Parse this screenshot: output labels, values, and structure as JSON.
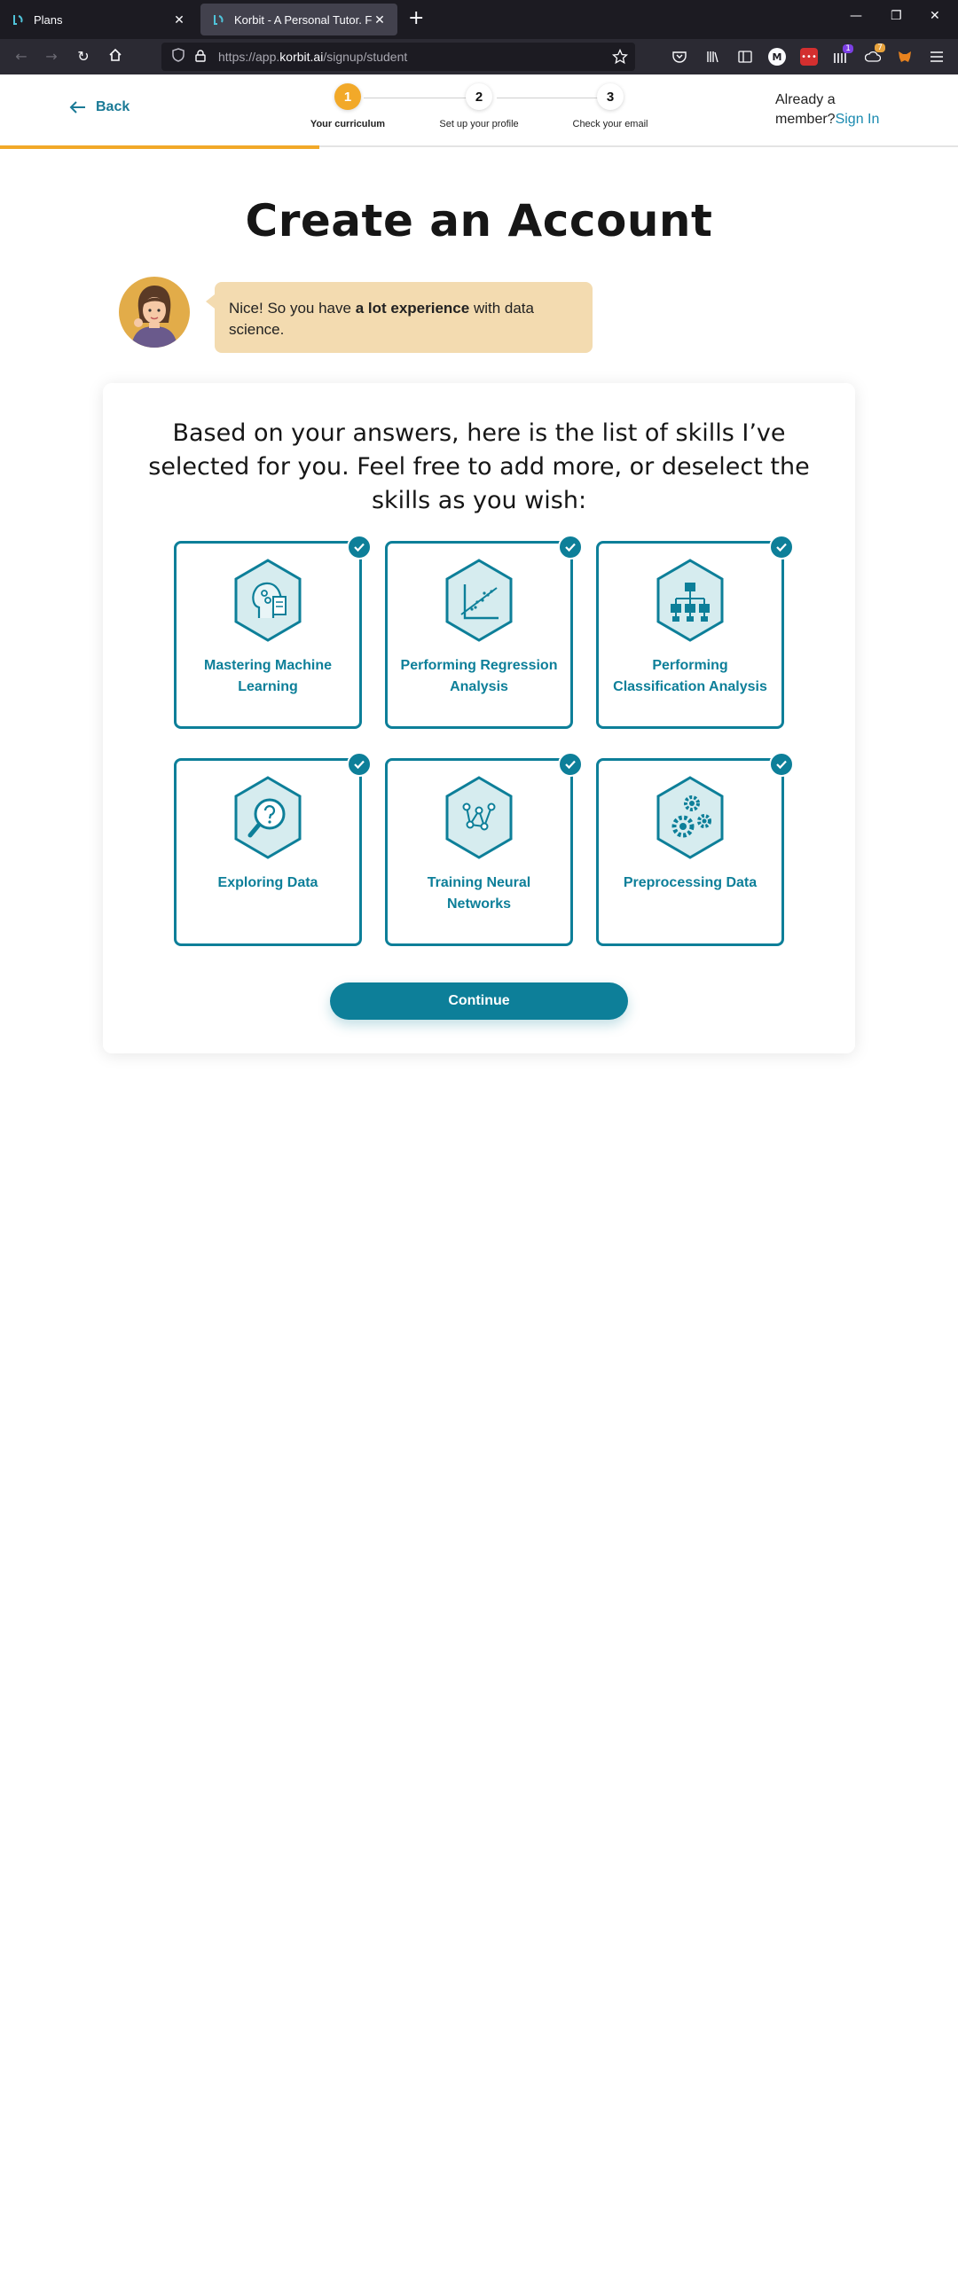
{
  "browser": {
    "tabs": [
      {
        "title": "Plans",
        "active": false
      },
      {
        "title": "Korbit - A Personal Tutor. For Ev",
        "active": true
      }
    ],
    "url_prefix": "https://app.",
    "url_domain": "korbit.ai",
    "url_path": "/signup/student",
    "new_tab": "+",
    "minimize": "—",
    "restore": "❐",
    "close": "✕",
    "ext_badge_1": "1",
    "ext_badge_2": "7"
  },
  "header": {
    "back_label": "Back",
    "steps": [
      {
        "number": "1",
        "label": "Your curriculum",
        "active": true
      },
      {
        "number": "2",
        "label": "Set up your profile",
        "active": false
      },
      {
        "number": "3",
        "label": "Check your email",
        "active": false
      }
    ],
    "member_text": "Already a member?",
    "signin_label": "Sign In",
    "progress_fraction": 0.333
  },
  "main": {
    "title": "Create an Account",
    "bubble_prefix": "Nice! So you have ",
    "bubble_bold": "a lot experience",
    "bubble_suffix": " with data science.",
    "prompt": "Based on your answers, here is the list of skills I’ve selected for you. Feel free to add more, or deselect the skills as you wish:",
    "skills": [
      {
        "name": "Mastering Machine Learning",
        "icon": "machine-learning-head-icon",
        "selected": true
      },
      {
        "name": "Performing Regression Analysis",
        "icon": "regression-chart-icon",
        "selected": true
      },
      {
        "name": "Performing Classification Analysis",
        "icon": "classification-tree-icon",
        "selected": true
      },
      {
        "name": "Exploring Data",
        "icon": "magnifier-question-icon",
        "selected": true
      },
      {
        "name": "Training Neural Networks",
        "icon": "neural-network-icon",
        "selected": true
      },
      {
        "name": "Preprocessing Data",
        "icon": "gears-icon",
        "selected": true
      }
    ],
    "continue_label": "Continue"
  },
  "colors": {
    "accent": "#0d7f99",
    "progress": "#f2a929",
    "bubble": "#f3dbb0",
    "icon_fill": "#d6ecef"
  }
}
